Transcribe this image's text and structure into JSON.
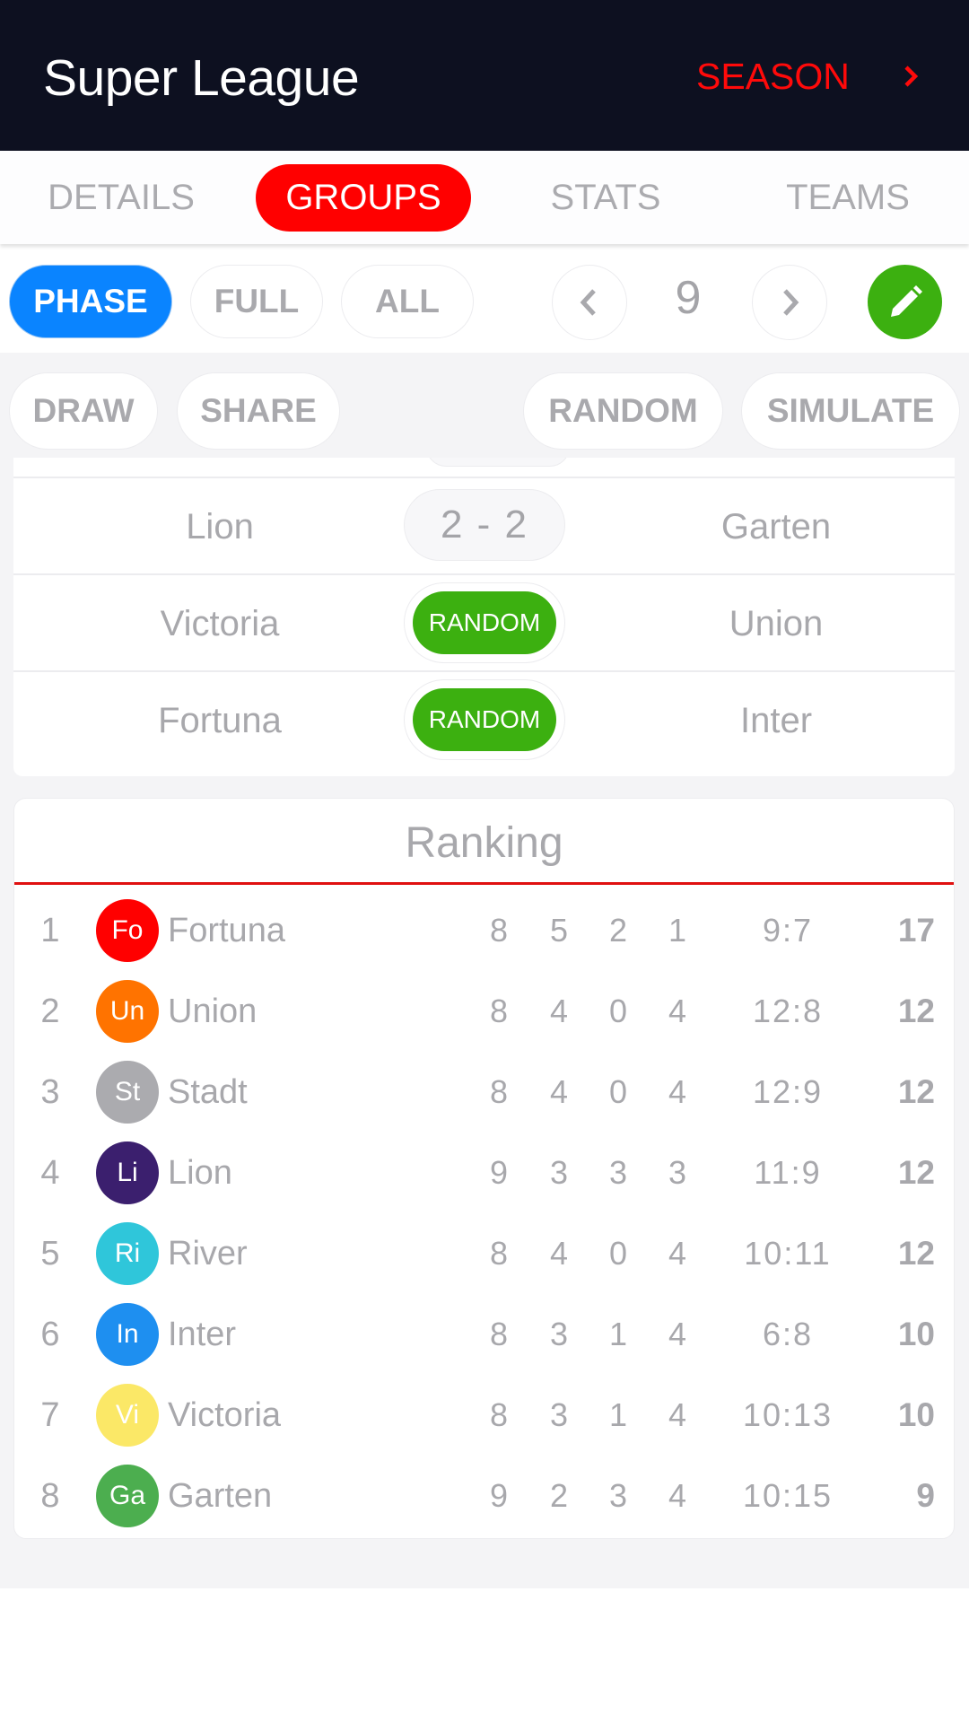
{
  "header": {
    "title": "Super League",
    "season_label": "SEASON"
  },
  "tabs": [
    {
      "label": "DETAILS",
      "active": false
    },
    {
      "label": "GROUPS",
      "active": true
    },
    {
      "label": "STATS",
      "active": false
    },
    {
      "label": "TEAMS",
      "active": false
    }
  ],
  "filters": {
    "phase": "PHASE",
    "full": "FULL",
    "all": "ALL",
    "selected": "PHASE",
    "matchday": "9"
  },
  "actions": {
    "draw": "DRAW",
    "share": "SHARE",
    "random": "RANDOM",
    "simulate": "SIMULATE"
  },
  "matches": [
    {
      "home": "Lion",
      "away": "Garten",
      "score": "2 - 2",
      "button": null
    },
    {
      "home": "Victoria",
      "away": "Union",
      "score": null,
      "button": "RANDOM"
    },
    {
      "home": "Fortuna",
      "away": "Inter",
      "score": null,
      "button": "RANDOM"
    }
  ],
  "ranking": {
    "title": "Ranking",
    "rows": [
      {
        "pos": "1",
        "abbr": "Fo",
        "team": "Fortuna",
        "color": "#ff0000",
        "played": "8",
        "won": "5",
        "drawn": "2",
        "lost": "1",
        "goals": "9:7",
        "points": "17"
      },
      {
        "pos": "2",
        "abbr": "Un",
        "team": "Union",
        "color": "#ff7300",
        "played": "8",
        "won": "4",
        "drawn": "0",
        "lost": "4",
        "goals": "12:8",
        "points": "12"
      },
      {
        "pos": "3",
        "abbr": "St",
        "team": "Stadt",
        "color": "#ababaf",
        "played": "8",
        "won": "4",
        "drawn": "0",
        "lost": "4",
        "goals": "12:9",
        "points": "12"
      },
      {
        "pos": "4",
        "abbr": "Li",
        "team": "Lion",
        "color": "#3b1f6e",
        "played": "9",
        "won": "3",
        "drawn": "3",
        "lost": "3",
        "goals": "11:9",
        "points": "12"
      },
      {
        "pos": "5",
        "abbr": "Ri",
        "team": "River",
        "color": "#2fc6da",
        "played": "8",
        "won": "4",
        "drawn": "0",
        "lost": "4",
        "goals": "10:11",
        "points": "12"
      },
      {
        "pos": "6",
        "abbr": "In",
        "team": "Inter",
        "color": "#1e8ff0",
        "played": "8",
        "won": "3",
        "drawn": "1",
        "lost": "4",
        "goals": "6:8",
        "points": "10"
      },
      {
        "pos": "7",
        "abbr": "Vi",
        "team": "Victoria",
        "color": "#fbe867",
        "played": "8",
        "won": "3",
        "drawn": "1",
        "lost": "4",
        "goals": "10:13",
        "points": "10"
      },
      {
        "pos": "8",
        "abbr": "Ga",
        "team": "Garten",
        "color": "#4cae4f",
        "played": "9",
        "won": "2",
        "drawn": "3",
        "lost": "4",
        "goals": "10:15",
        "points": "9"
      }
    ]
  },
  "colors": {
    "header_bg": "#0d1020",
    "accent_red": "#ff0000",
    "phase_blue": "#0a84ff",
    "random_green": "#3cb010"
  }
}
